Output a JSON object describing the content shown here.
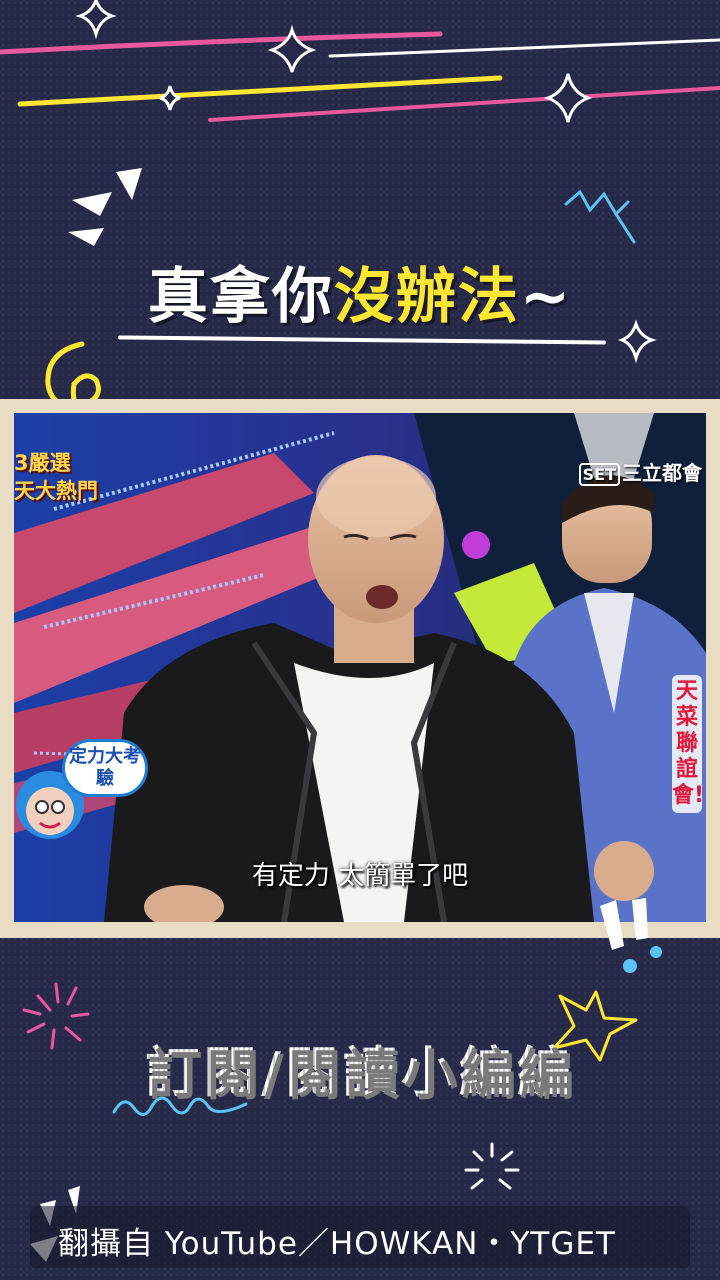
{
  "headline": {
    "part_white": "真拿你",
    "part_yellow": "沒辦法",
    "tilde": "~"
  },
  "video": {
    "bug_left_line1": "3嚴選",
    "bug_left_line2": "天大熱門",
    "channel_logo": "SET",
    "channel_name": "三立都會",
    "side_title": "天菜聯誼會!",
    "bubble_text": "定力大考驗",
    "subtitle": "有定力  太簡單了吧"
  },
  "section_title": "訂閱/閱讀小編編",
  "credit": "翻攝自 YouTube／HOWKAN・YTGET",
  "colors": {
    "background": "#262a48",
    "accent_yellow": "#ffe733",
    "accent_pink": "#e9579f",
    "frame": "#e8dcc4"
  },
  "icons": [
    "sparkle-icon",
    "arrow-curl-icon",
    "burst-icon",
    "starburst-icon",
    "exclamation-icon"
  ]
}
